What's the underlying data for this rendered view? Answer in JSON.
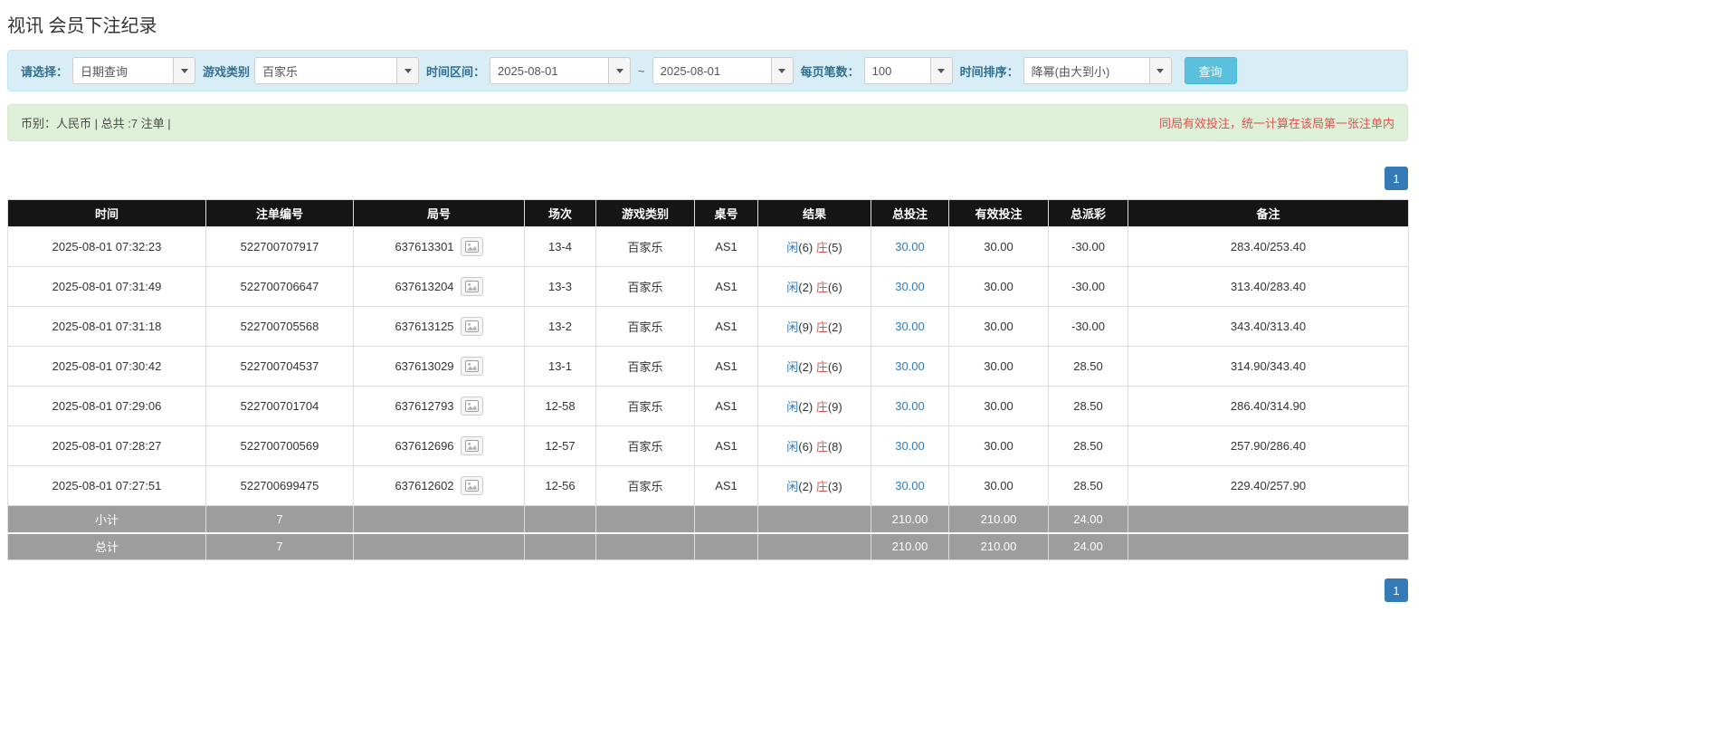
{
  "page_title": "视讯 会员下注纪录",
  "filters": {
    "select_label": "请选择：",
    "select_value": "日期查询",
    "game_type_label": "游戏类别",
    "game_type_value": "百家乐",
    "time_range_label": "时间区间：",
    "time_from": "2025-08-01",
    "range_separator": "~",
    "time_to": "2025-08-01",
    "page_size_label": "每页笔数：",
    "page_size_value": "100",
    "sort_label": "时间排序：",
    "sort_value": "降幂(由大到小)",
    "search_button_label": "查询"
  },
  "summary": {
    "left_text": "币别：人民币 | 总共 :7 注单 |",
    "right_text": "同局有效投注，统一计算在该局第一张注单内"
  },
  "pagination": {
    "current_page": "1"
  },
  "colors": {
    "accent_blue": "#337ab7",
    "player_blue": "#337ab7",
    "banker_red": "#d9534f",
    "negative_red": "#e23b3b",
    "header_black": "#151515",
    "footer_gray": "#9d9d9d",
    "filter_bg": "#d9edf7",
    "summary_bg": "#dff0d8"
  },
  "icons": {
    "dropdown_caret": "chevron-down-icon",
    "roadmap_thumbnail": "picture-icon"
  },
  "table": {
    "headers": [
      "时间",
      "注单编号",
      "局号",
      "场次",
      "游戏类别",
      "桌号",
      "结果",
      "总投注",
      "有效投注",
      "总派彩",
      "备注"
    ],
    "result_labels": {
      "player": "闲",
      "banker": "庄"
    },
    "rows": [
      {
        "time": "2025-08-01 07:32:23",
        "bet_id": "522700707917",
        "round_id": "637613301",
        "session": "13-4",
        "game": "百家乐",
        "table": "AS1",
        "player_score": "6",
        "banker_score": "5",
        "total_bet": "30.00",
        "valid_bet": "30.00",
        "payout": "-30.00",
        "remark": "283.40/253.40"
      },
      {
        "time": "2025-08-01 07:31:49",
        "bet_id": "522700706647",
        "round_id": "637613204",
        "session": "13-3",
        "game": "百家乐",
        "table": "AS1",
        "player_score": "2",
        "banker_score": "6",
        "total_bet": "30.00",
        "valid_bet": "30.00",
        "payout": "-30.00",
        "remark": "313.40/283.40"
      },
      {
        "time": "2025-08-01 07:31:18",
        "bet_id": "522700705568",
        "round_id": "637613125",
        "session": "13-2",
        "game": "百家乐",
        "table": "AS1",
        "player_score": "9",
        "banker_score": "2",
        "total_bet": "30.00",
        "valid_bet": "30.00",
        "payout": "-30.00",
        "remark": "343.40/313.40"
      },
      {
        "time": "2025-08-01 07:30:42",
        "bet_id": "522700704537",
        "round_id": "637613029",
        "session": "13-1",
        "game": "百家乐",
        "table": "AS1",
        "player_score": "2",
        "banker_score": "6",
        "total_bet": "30.00",
        "valid_bet": "30.00",
        "payout": "28.50",
        "remark": "314.90/343.40"
      },
      {
        "time": "2025-08-01 07:29:06",
        "bet_id": "522700701704",
        "round_id": "637612793",
        "session": "12-58",
        "game": "百家乐",
        "table": "AS1",
        "player_score": "2",
        "banker_score": "9",
        "total_bet": "30.00",
        "valid_bet": "30.00",
        "payout": "28.50",
        "remark": "286.40/314.90"
      },
      {
        "time": "2025-08-01 07:28:27",
        "bet_id": "522700700569",
        "round_id": "637612696",
        "session": "12-57",
        "game": "百家乐",
        "table": "AS1",
        "player_score": "6",
        "banker_score": "8",
        "total_bet": "30.00",
        "valid_bet": "30.00",
        "payout": "28.50",
        "remark": "257.90/286.40"
      },
      {
        "time": "2025-08-01 07:27:51",
        "bet_id": "522700699475",
        "round_id": "637612602",
        "session": "12-56",
        "game": "百家乐",
        "table": "AS1",
        "player_score": "2",
        "banker_score": "3",
        "total_bet": "30.00",
        "valid_bet": "30.00",
        "payout": "28.50",
        "remark": "229.40/257.90"
      }
    ],
    "footer_rows": [
      {
        "label": "小计",
        "count": "7",
        "total_bet": "210.00",
        "valid_bet": "210.00",
        "payout": "24.00"
      },
      {
        "label": "总计",
        "count": "7",
        "total_bet": "210.00",
        "valid_bet": "210.00",
        "payout": "24.00"
      }
    ]
  }
}
